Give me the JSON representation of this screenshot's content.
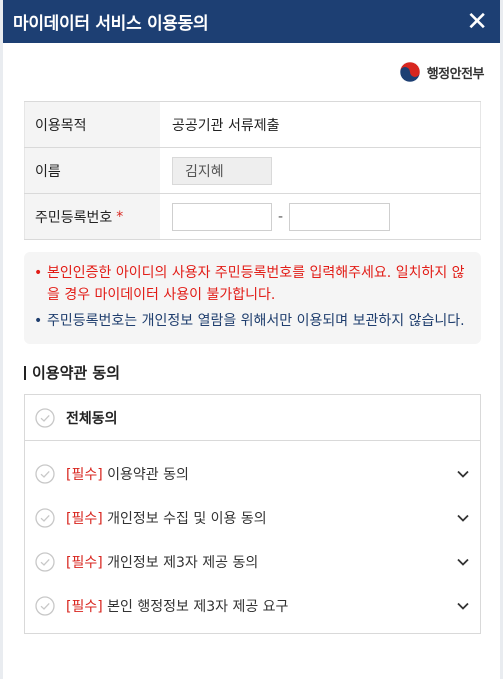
{
  "dialog": {
    "title": "마이데이터 서비스 이용동의",
    "close_glyph": "✕"
  },
  "brand": {
    "logo_text": "행정안전부"
  },
  "info": {
    "purpose_label": "이용목적",
    "purpose_value": "공공기관 서류제출",
    "name_label": "이름",
    "name_value": "김지혜",
    "rrn_label": "주민등록번호",
    "required_mark": "*",
    "rrn_separator": "-",
    "rrn_front_value": "",
    "rrn_back_value": ""
  },
  "notice": {
    "items": [
      {
        "text": "본인인증한 아이디의 사용자 주민등록번호를 입력해주세요. 일치하지 않을 경우 마이데이터 사용이 불가합니다.",
        "color": "#e21d17"
      },
      {
        "text": "주민등록번호는 개인정보 열람을 위해서만 이용되며 보관하지 않습니다.",
        "color": "#1f3e6e"
      }
    ],
    "bullet": "•"
  },
  "terms": {
    "section_title": "이용약관 동의",
    "agree_all_label": "전체동의",
    "required_tag": "[필수]",
    "items": [
      {
        "label": "이용약관 동의"
      },
      {
        "label": "개인정보 수집 및 이용 동의"
      },
      {
        "label": "개인정보 제3자 제공 동의"
      },
      {
        "label": "본인 행정정보 제3자 제공 요구"
      }
    ]
  },
  "colors": {
    "header_bg": "#1d3f73",
    "required_red": "#d8261f",
    "notice_red": "#e21d17",
    "notice_blue": "#1f3e6e"
  },
  "icons": {
    "close": "close-icon",
    "check": "check-circle-icon",
    "chevron": "chevron-down-icon",
    "logo": "taegeuk-logo-icon"
  }
}
